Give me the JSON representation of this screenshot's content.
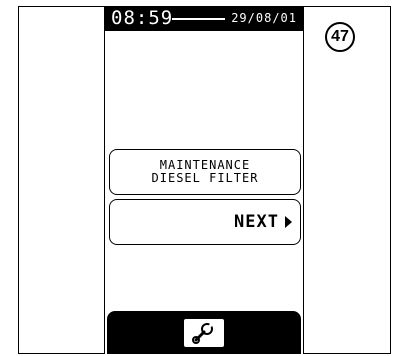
{
  "status": {
    "time": "08:59",
    "date": "29/08/01"
  },
  "message": {
    "line1": "MAINTENANCE",
    "line2": "DIESEL FILTER"
  },
  "buttons": {
    "next_label": "NEXT"
  },
  "page": {
    "number": "47"
  },
  "icons": {
    "next_arrow": "right-triangle-icon",
    "tool": "wrench-icon"
  }
}
